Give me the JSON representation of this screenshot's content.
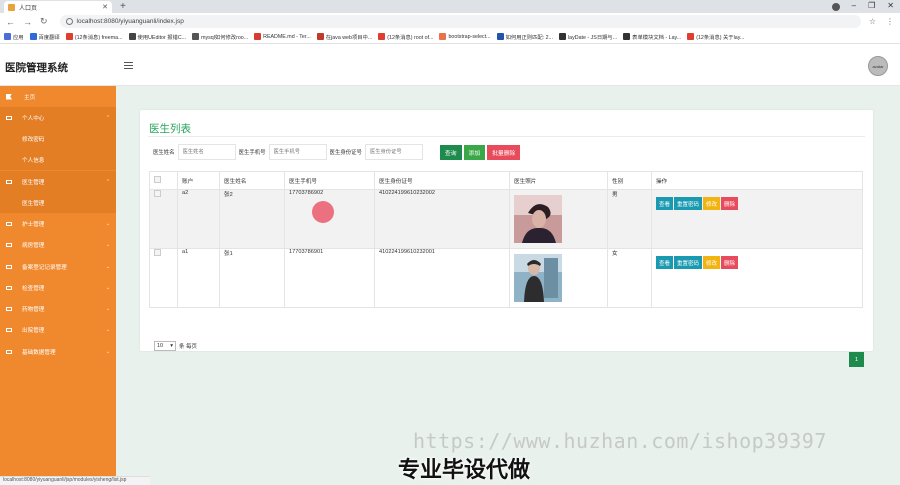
{
  "browser": {
    "tab_title": "人口页",
    "url": "localhost:8080/yiyuanguanli/index.jsp",
    "bookmarks": [
      {
        "label": "应用",
        "color": "#4b6cd9"
      },
      {
        "label": "百度翻译",
        "color": "#2e6bd8"
      },
      {
        "label": "(12条消息) freema...",
        "color": "#e03e2d"
      },
      {
        "label": "使用UEditor 报错C...",
        "color": "#444444"
      },
      {
        "label": "mysql如何修改roo...",
        "color": "#555555"
      },
      {
        "label": "README.md - Ter...",
        "color": "#d93b30"
      },
      {
        "label": "在java web项目中...",
        "color": "#c0392b"
      },
      {
        "label": "(12条消息) root of...",
        "color": "#e03e2d"
      },
      {
        "label": "bootstrap-select...",
        "color": "#e8734a"
      },
      {
        "label": "如何用正则匹配: 2...",
        "color": "#2255aa"
      },
      {
        "label": "layDate - JS日期与...",
        "color": "#333333"
      },
      {
        "label": "表单模块文档 - Lay...",
        "color": "#333333"
      },
      {
        "label": "(12条消息) 关于lay...",
        "color": "#e03e2d"
      }
    ],
    "status_bar": "localhost:8080/yiyuanguanli/jsp/modules/yisheng/list.jsp"
  },
  "header": {
    "brand": "医院管理系统",
    "avatar_text": "avatar"
  },
  "sidebar": {
    "items": [
      {
        "label": "主页",
        "type": "home"
      },
      {
        "label": "个人中心",
        "type": "group",
        "open": true
      },
      {
        "label": "修改密码",
        "type": "sub"
      },
      {
        "label": "个人信息",
        "type": "sub"
      },
      {
        "label": "医生管理",
        "type": "group",
        "open": true
      },
      {
        "label": "医生管理",
        "type": "sub"
      },
      {
        "label": "护士管理",
        "type": "group"
      },
      {
        "label": "病房管理",
        "type": "group"
      },
      {
        "label": "备案登记记录管理",
        "type": "group"
      },
      {
        "label": "检查管理",
        "type": "group"
      },
      {
        "label": "药物管理",
        "type": "group"
      },
      {
        "label": "出院管理",
        "type": "group"
      },
      {
        "label": "基础数据管理",
        "type": "group"
      }
    ]
  },
  "page": {
    "title": "医生列表",
    "search": {
      "name_label": "医生姓名",
      "name_placeholder": "医生姓名",
      "phone_label": "医生手机号",
      "phone_placeholder": "医生手机号",
      "id_label": "医生身份证号",
      "id_placeholder": "医生身份证号",
      "search_btn": "查询",
      "add_btn": "添加",
      "batch_delete_btn": "批量删除"
    },
    "table": {
      "headers": [
        "账户",
        "医生姓名",
        "医生手机号",
        "医生身份证号",
        "医生照片",
        "性别",
        "操作"
      ],
      "rows": [
        {
          "account": "a2",
          "name": "张2",
          "phone": "17703786902",
          "id_card": "410224199610232002",
          "gender": "男"
        },
        {
          "account": "a1",
          "name": "张1",
          "phone": "17703786901",
          "id_card": "410224199610232001",
          "gender": "女"
        }
      ],
      "ops": {
        "view": "查看",
        "reset": "重置密码",
        "edit": "修改",
        "delete": "删除"
      }
    },
    "page_size": "10",
    "page_size_suffix": "条 每页",
    "current_page": "1"
  },
  "watermark": "https://www.huzhan.com/ishop39397",
  "overlay_text": "专业毕设代做"
}
